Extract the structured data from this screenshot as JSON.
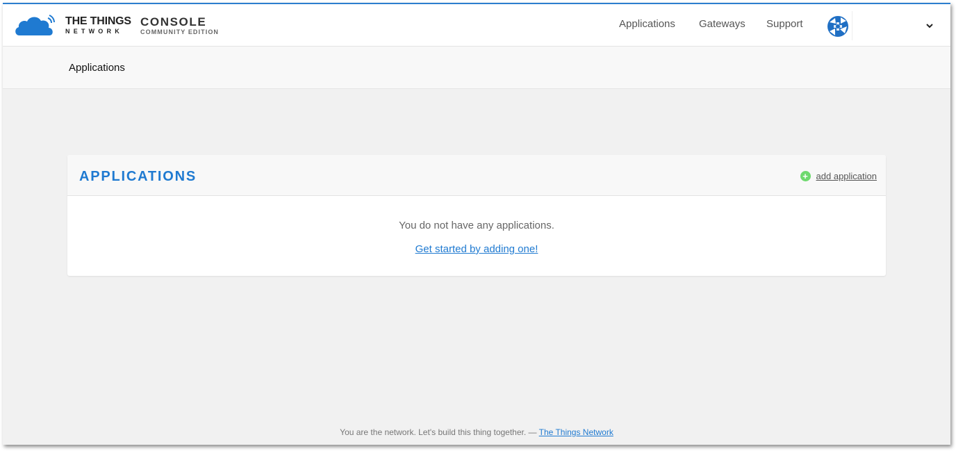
{
  "header": {
    "brand_line1": "THE THINGS",
    "brand_line2": "NETWORK",
    "console_title": "CONSOLE",
    "console_subtitle": "COMMUNITY EDITION",
    "nav": {
      "applications": "Applications",
      "gateways": "Gateways",
      "support": "Support"
    }
  },
  "breadcrumb": {
    "current": "Applications"
  },
  "applications_card": {
    "title": "APPLICATIONS",
    "add_label": "add application",
    "empty_message": "You do not have any applications.",
    "get_started_link": "Get started by adding one!"
  },
  "footer": {
    "tagline": "You are the network. Let's build this thing together. — ",
    "link": "The Things Network"
  },
  "colors": {
    "accent": "#1f7ad1",
    "add_icon": "#6ed96e",
    "top_border": "#2d7fcf"
  },
  "icons": {
    "logo": "ttn-cloud-logo",
    "avatar": "user-avatar-icon",
    "chevron": "chevron-down-icon",
    "add": "plus-circle-icon"
  }
}
